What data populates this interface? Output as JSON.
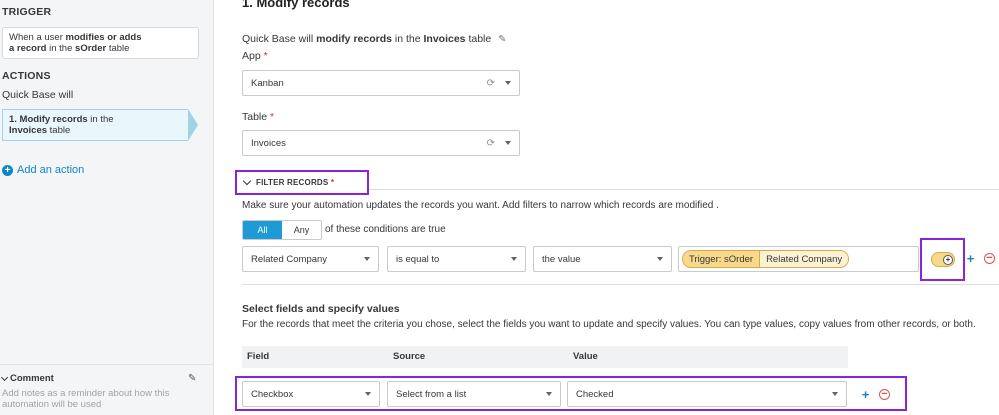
{
  "sidebar": {
    "trigger_title": "TRIGGER",
    "trigger_card": {
      "prefix": "When a user ",
      "bold1": "modifies or adds",
      "bold2": "a record",
      "mid": " in the ",
      "bold3": "sOrder",
      "suffix": " table"
    },
    "actions_title": "ACTIONS",
    "actions_intro": "Quick Base will",
    "action_card": {
      "bold1": "1. Modify records",
      "mid": " in the",
      "bold2": "Invoices",
      "suffix": " table"
    },
    "add_action": "Add an action",
    "comment_title": "Comment",
    "comment_placeholder": "Add notes as a reminder about how this automation will be used"
  },
  "main": {
    "title": "1. Modify records",
    "intro": {
      "prefix": "Quick Base will ",
      "bold1": "modify records",
      "mid": " in the ",
      "bold2": "Invoices",
      "suffix": " table"
    },
    "app_label": "App",
    "app_value": "Kanban",
    "table_label": "Table",
    "table_value": "Invoices",
    "required_mark": "*",
    "filter_title": "FILTER RECORDS",
    "filter_desc": "Make sure your automation updates the records you want. Add filters to narrow which records are modified .",
    "match_options": [
      "All",
      "Any"
    ],
    "match_selected": "All",
    "conditions_text": "of these conditions are true",
    "filter_row": {
      "field": "Related Company",
      "operator": "is equal to",
      "value_type": "the value",
      "chip_source": "Trigger: sOrder",
      "chip_field": "Related Company"
    },
    "fields_title": "Select fields and specify values",
    "fields_desc": "For the records that meet the criteria you chose, select the fields you want to update and specify values. You can type values, copy values from other records, or both.",
    "table_headers": {
      "field": "Field",
      "source": "Source",
      "value": "Value"
    },
    "field_row": {
      "field": "Checkbox",
      "source": "Select from a list",
      "value": "Checked"
    }
  },
  "colors": {
    "accent": "#1e9ad6",
    "highlight": "#8a24d8",
    "chip": "#f8d98a",
    "required": "#c0392b"
  },
  "icons": [
    "pencil-icon",
    "refresh-icon",
    "chevron-down-icon",
    "plus-circle-icon",
    "plus-icon",
    "minus-icon",
    "insert-field-icon"
  ]
}
